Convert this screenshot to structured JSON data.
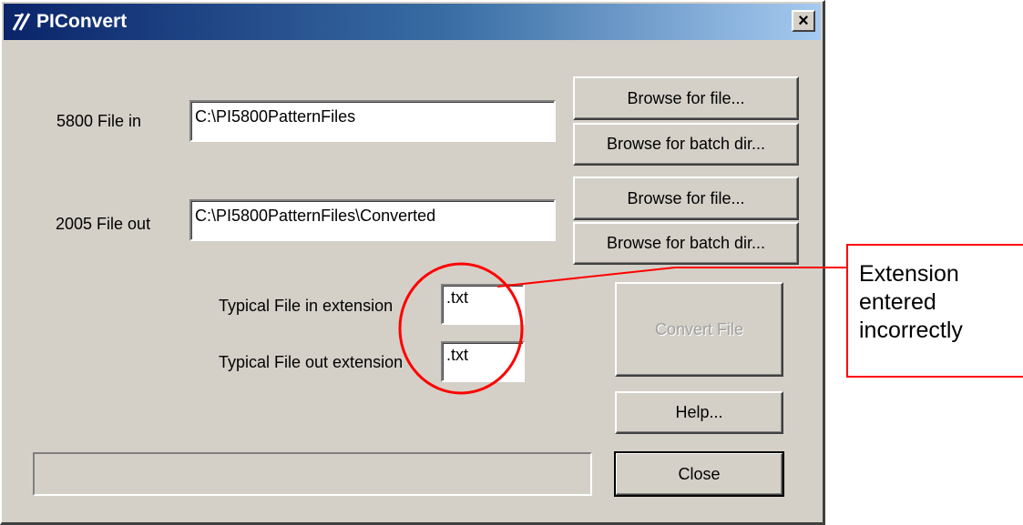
{
  "window": {
    "title": "PIConvert",
    "close_label": "×"
  },
  "fields": {
    "file_in_label": "5800 File in",
    "file_in_value": "C:\\PI5800PatternFiles",
    "file_out_label": "2005 File out",
    "file_out_value": "C:\\PI5800PatternFiles\\Converted",
    "ext_in_label": "Typical File in extension",
    "ext_in_value": ".txt",
    "ext_out_label": "Typical File out extension",
    "ext_out_value": ".txt"
  },
  "buttons": {
    "browse_file_in": "Browse for file...",
    "browse_batch_in": "Browse for batch dir...",
    "browse_file_out": "Browse for file...",
    "browse_batch_out": "Browse for batch dir...",
    "convert": "Convert File",
    "help": "Help...",
    "close": "Close"
  },
  "annotation": {
    "text": "Extension entered incorrectly",
    "color": "#ff0000"
  },
  "icons": {
    "app": "piconvert-app-icon",
    "close": "close-icon"
  }
}
